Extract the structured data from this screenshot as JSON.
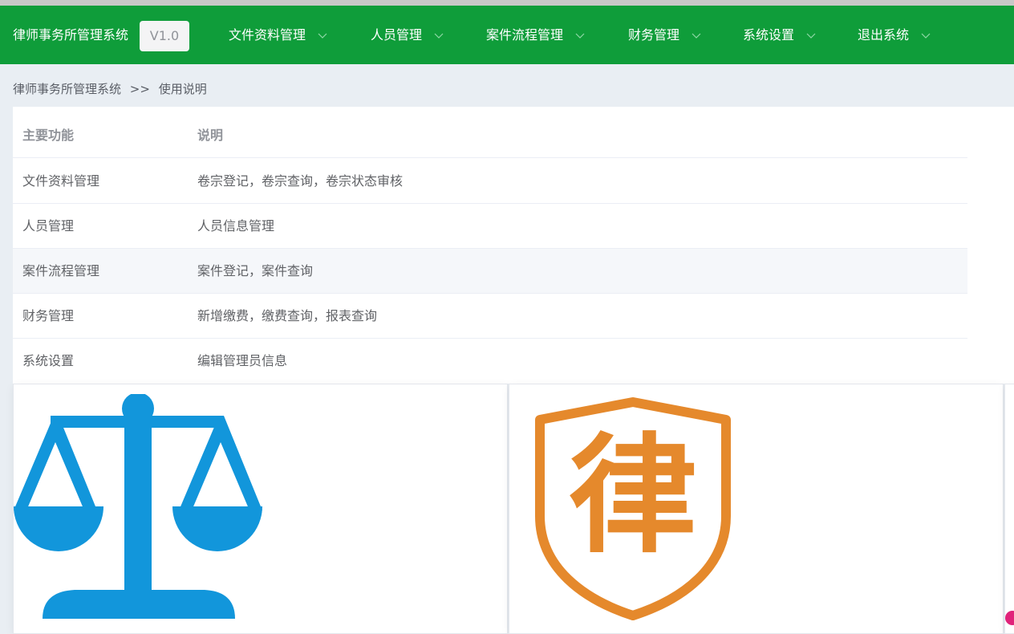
{
  "header": {
    "brand": "律师事务所管理系统",
    "version": "V1.0",
    "menus": [
      {
        "label": "文件资料管理"
      },
      {
        "label": "人员管理"
      },
      {
        "label": "案件流程管理"
      },
      {
        "label": "财务管理"
      },
      {
        "label": "系统设置"
      },
      {
        "label": "退出系统"
      }
    ]
  },
  "breadcrumb": {
    "root": "律师事务所管理系统",
    "separator": ">>",
    "current": "使用说明"
  },
  "table": {
    "headers": [
      "主要功能",
      "说明"
    ],
    "rows": [
      {
        "feature": "文件资料管理",
        "desc": "卷宗登记，卷宗查询，卷宗状态审核"
      },
      {
        "feature": "人员管理",
        "desc": "人员信息管理"
      },
      {
        "feature": "案件流程管理",
        "desc": "案件登记，案件查询"
      },
      {
        "feature": "财务管理",
        "desc": "新增缴费，缴费查询，报表查询"
      },
      {
        "feature": "系统设置",
        "desc": "编辑管理员信息"
      }
    ]
  },
  "cards": {
    "logo1_icon": "scales-of-justice-icon",
    "logo2_icon": "law-shield-icon",
    "logo2_char": "律",
    "colors": {
      "brand_green": "#0f9d3a",
      "scales_blue": "#1296db",
      "shield_orange": "#e5892c"
    }
  }
}
